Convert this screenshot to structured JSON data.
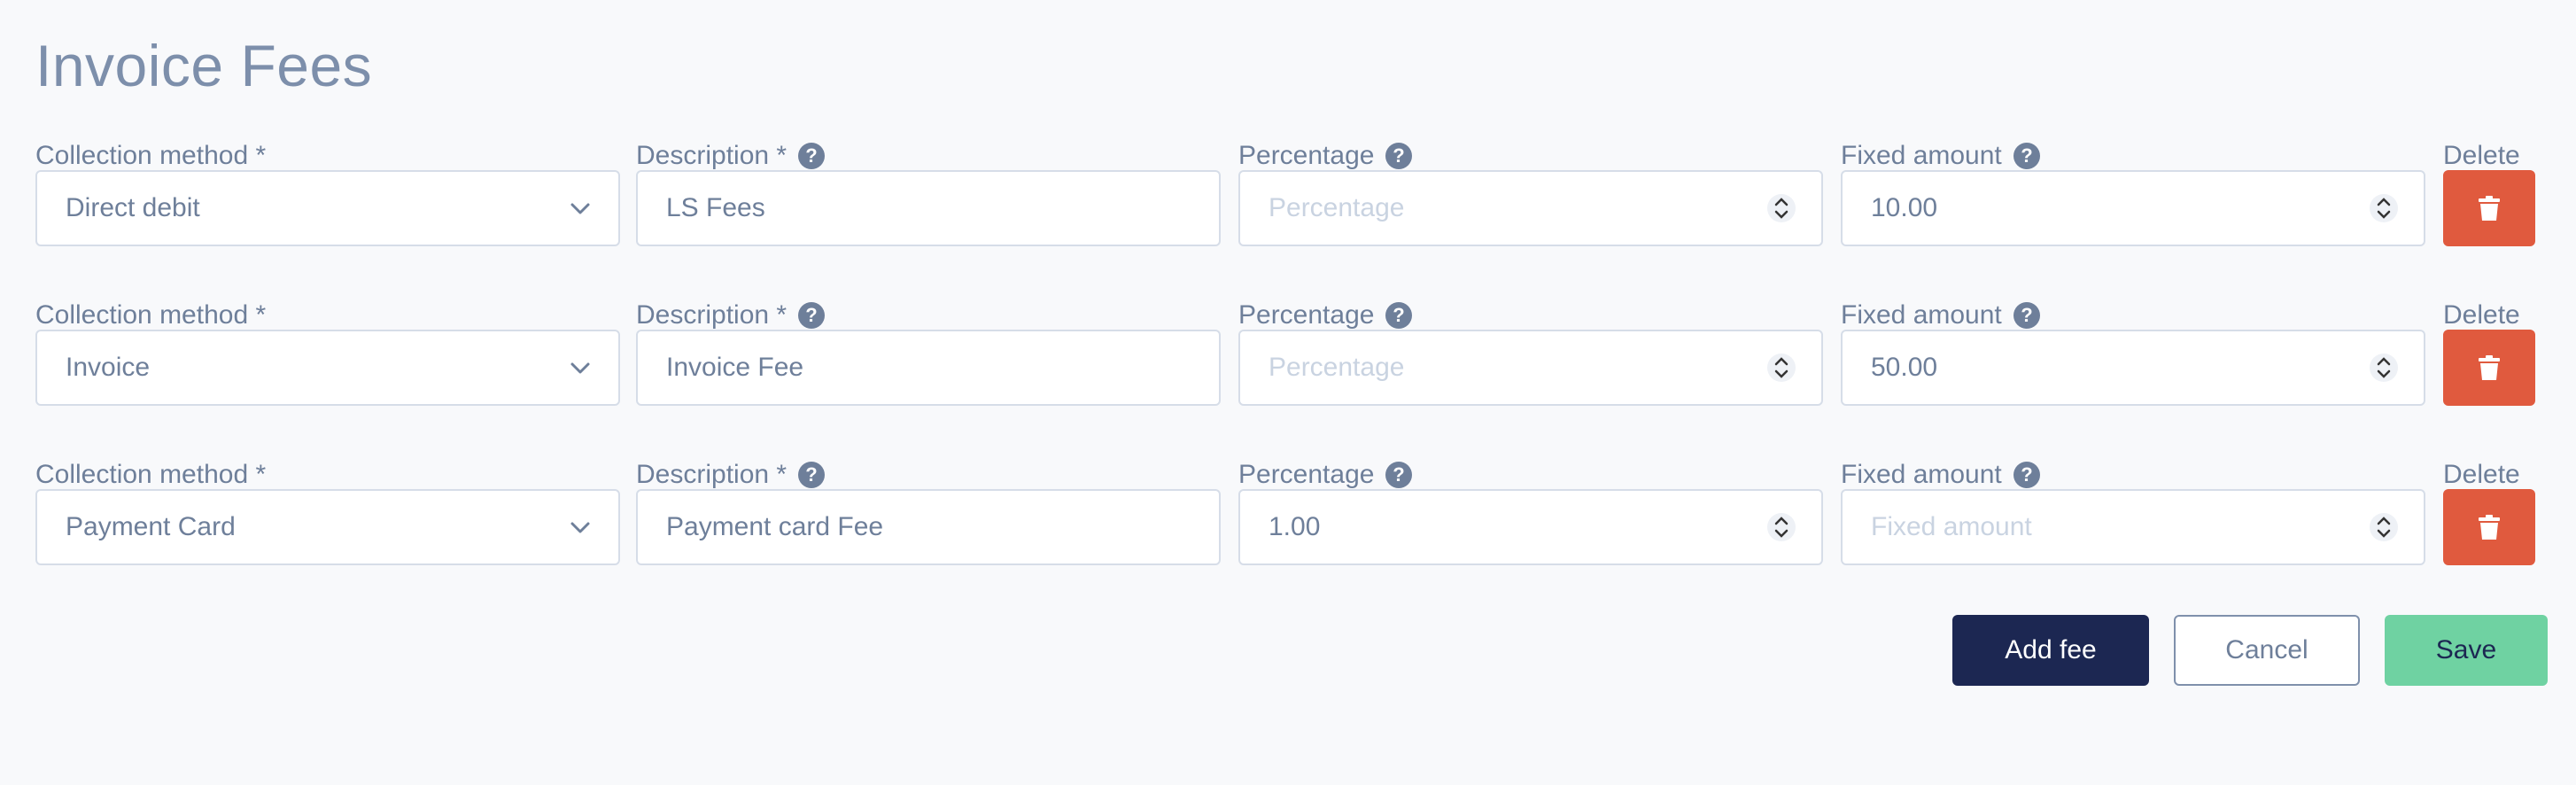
{
  "page": {
    "title": "Invoice Fees"
  },
  "labels": {
    "collection_method": "Collection method *",
    "description": "Description *",
    "percentage": "Percentage",
    "fixed_amount": "Fixed amount",
    "delete": "Delete"
  },
  "rows": [
    {
      "collection_method": "Direct debit",
      "description": "LS Fees",
      "percentage": "",
      "percentage_placeholder": "Percentage",
      "fixed_amount": "10.00",
      "fixed_amount_placeholder": ""
    },
    {
      "collection_method": "Invoice",
      "description": "Invoice Fee",
      "percentage": "",
      "percentage_placeholder": "Percentage",
      "fixed_amount": "50.00",
      "fixed_amount_placeholder": ""
    },
    {
      "collection_method": "Payment Card",
      "description": "Payment card Fee",
      "percentage": "1.00",
      "percentage_placeholder": "",
      "fixed_amount": "",
      "fixed_amount_placeholder": "Fixed amount"
    }
  ],
  "actions": {
    "add_fee": "Add fee",
    "cancel": "Cancel",
    "save": "Save"
  },
  "icons": {
    "help": "question-circle-icon",
    "dropdown": "chevron-down-icon",
    "stepper": "number-stepper-icon",
    "delete": "trash-icon"
  },
  "colors": {
    "background": "#f8f9fb",
    "text": "#6e7f9a",
    "delete": "#e05a3e",
    "primary": "#1c2752",
    "save": "#6fd2a2",
    "border": "#d6dde8"
  }
}
